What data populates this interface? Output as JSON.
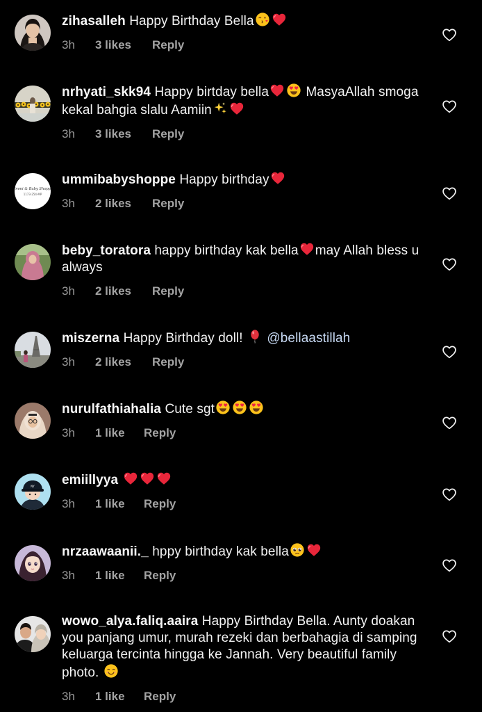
{
  "comments": [
    {
      "username": "zihasalleh",
      "segments": [
        {
          "text": " Happy Birthday Bella"
        },
        {
          "emoji": "kissing-face-emoji"
        },
        {
          "emoji": "red-heart-emoji"
        }
      ],
      "time": "3h",
      "likes": "3 likes",
      "reply": "Reply",
      "avatar_icon": "avatar-portrait"
    },
    {
      "username": "nrhyati_skk94",
      "segments": [
        {
          "text": " Happy birtday bella"
        },
        {
          "emoji": "red-heart-emoji"
        },
        {
          "emoji": "heart-eyes-emoji"
        },
        {
          "text": " MasyaAllah smoga kekal bahgia slalu Aamiin"
        },
        {
          "emoji": "sparkles-emoji"
        },
        {
          "emoji": "red-heart-emoji"
        }
      ],
      "time": "3h",
      "likes": "3 likes",
      "reply": "Reply",
      "avatar_icon": "avatar-sunflower"
    },
    {
      "username": "ummibabyshoppe",
      "segments": [
        {
          "text": " Happy birthday"
        },
        {
          "emoji": "red-heart-emoji"
        }
      ],
      "time": "3h",
      "likes": "2 likes",
      "reply": "Reply",
      "avatar_icon": "avatar-logo"
    },
    {
      "username": "beby_toratora",
      "segments": [
        {
          "text": " happy birthday kak bella"
        },
        {
          "emoji": "red-heart-emoji"
        },
        {
          "text": "may Allah bless u always"
        }
      ],
      "time": "3h",
      "likes": "2 likes",
      "reply": "Reply",
      "avatar_icon": "avatar-hijab-pink"
    },
    {
      "username": "miszerna",
      "segments": [
        {
          "text": " Happy Birthday doll! "
        },
        {
          "emoji": "balloon-emoji"
        },
        {
          "text": " "
        },
        {
          "mention": "@bellaastillah"
        }
      ],
      "time": "3h",
      "likes": "2 likes",
      "reply": "Reply",
      "avatar_icon": "avatar-eiffel"
    },
    {
      "username": "nurulfathiahalia",
      "segments": [
        {
          "text": " Cute sgt"
        },
        {
          "emoji": "heart-eyes-emoji"
        },
        {
          "emoji": "heart-eyes-emoji"
        },
        {
          "emoji": "heart-eyes-emoji"
        }
      ],
      "time": "3h",
      "likes": "1 like",
      "reply": "Reply",
      "avatar_icon": "avatar-hijab-glasses"
    },
    {
      "username": "emiillyya",
      "segments": [
        {
          "text": " "
        },
        {
          "emoji": "red-heart-emoji"
        },
        {
          "emoji": "red-heart-emoji"
        },
        {
          "emoji": "red-heart-emoji"
        }
      ],
      "time": "3h",
      "likes": "1 like",
      "reply": "Reply",
      "avatar_icon": "avatar-cartoon-cap"
    },
    {
      "username": "nrzaawaanii._",
      "segments": [
        {
          "text": " hppy birthday kak bella"
        },
        {
          "emoji": "pleading-face-emoji"
        },
        {
          "emoji": "red-heart-emoji"
        }
      ],
      "time": "3h",
      "likes": "1 like",
      "reply": "Reply",
      "avatar_icon": "avatar-cartoon-girl"
    },
    {
      "username": "wowo_alya.faliq.aaira",
      "segments": [
        {
          "text": " Happy Birthday Bella. Aunty doakan you panjang umur, murah rezeki dan berbahagia di samping keluarga tercinta hingga ke Jannah. Very beautiful family photo. "
        },
        {
          "emoji": "smiling-face-emoji"
        }
      ],
      "time": "3h",
      "likes": "1 like",
      "reply": "Reply",
      "avatar_icon": "avatar-couple"
    }
  ],
  "like_button_icon": "heart-outline-icon",
  "colors": {
    "background": "#000000",
    "text": "#f2f2f2",
    "meta": "#9a9a9a",
    "mention": "#c6d8f2",
    "heart": "#e8263a"
  }
}
